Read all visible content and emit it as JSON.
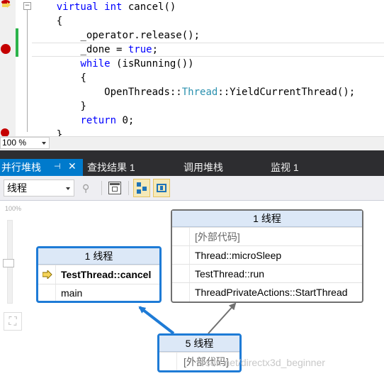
{
  "editor": {
    "lines": [
      {
        "indent": 2,
        "parts": [
          {
            "t": "virtual ",
            "c": "kw"
          },
          {
            "t": "int ",
            "c": "kw"
          },
          {
            "t": "cancel()",
            "c": ""
          }
        ]
      },
      {
        "indent": 2,
        "parts": [
          {
            "t": "{",
            "c": ""
          }
        ]
      },
      {
        "indent": 4,
        "parts": [
          {
            "t": "_operator.release();",
            "c": ""
          }
        ]
      },
      {
        "indent": 4,
        "parts": [
          {
            "t": "_done = ",
            "c": ""
          },
          {
            "t": "true",
            "c": "kw"
          },
          {
            "t": ";",
            "c": ""
          }
        ]
      },
      {
        "indent": 4,
        "parts": [
          {
            "t": "while ",
            "c": "kw"
          },
          {
            "t": "(isRunning())",
            "c": ""
          }
        ]
      },
      {
        "indent": 4,
        "parts": [
          {
            "t": "{",
            "c": ""
          }
        ]
      },
      {
        "indent": 6,
        "parts": [
          {
            "t": "OpenThreads::",
            "c": ""
          },
          {
            "t": "Thread",
            "c": "ty"
          },
          {
            "t": "::YieldCurrentThread();",
            "c": ""
          }
        ]
      },
      {
        "indent": 4,
        "parts": [
          {
            "t": "}",
            "c": ""
          }
        ]
      },
      {
        "indent": 4,
        "parts": [
          {
            "t": "return ",
            "c": "kw"
          },
          {
            "t": "0;",
            "c": ""
          }
        ]
      },
      {
        "indent": 2,
        "parts": [
          {
            "t": "}",
            "c": ""
          }
        ]
      }
    ],
    "zoom": "100 %",
    "collapse_glyph": "−"
  },
  "tabs": {
    "active": "并行堆栈",
    "pin_glyph": "⊣",
    "close_glyph": "✕",
    "items": [
      "查找结果 1",
      "调用堆栈",
      "监视 1"
    ]
  },
  "toolbar": {
    "thread_select": "线程",
    "filter_glyph": "⚲"
  },
  "canvas": {
    "zoom_pct": "100%",
    "fit_glyph": "⛶",
    "nodes": [
      {
        "id": "node-right",
        "header": "1 线程",
        "rows": [
          "[外部代码]",
          "Thread::microSleep",
          "TestThread::run",
          "ThreadPrivateActions::StartThread"
        ],
        "current_row": -1,
        "highlighted": false
      },
      {
        "id": "node-left",
        "header": "1 线程",
        "rows": [
          "TestThread::cancel",
          "main"
        ],
        "current_row": 0,
        "highlighted": true
      },
      {
        "id": "node-bottom",
        "header": "5 线程",
        "rows": [
          "[外部代码]"
        ],
        "current_row": -1,
        "highlighted": true
      }
    ],
    "watermark": "sdn.net/directx3d_beginner"
  },
  "colors": {
    "accent": "#007acc",
    "node_border_selected": "#1e7bd6",
    "node_border_normal": "#707070",
    "keyword": "#0000ff",
    "type": "#2b91af",
    "breakpoint": "#c50000",
    "current_arrow": "#f5d45a"
  }
}
